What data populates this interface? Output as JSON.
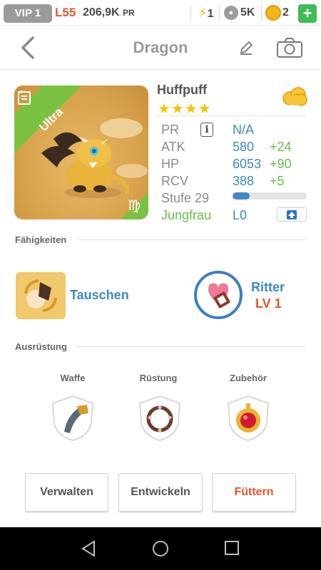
{
  "topbar": {
    "vip": "VIP 1",
    "level": "L55",
    "pr_value": "206,9K",
    "pr_unit": "PR",
    "energy": "1",
    "paws": "5K",
    "coins": "2",
    "plus": "+"
  },
  "header": {
    "title": "Dragon"
  },
  "pet": {
    "rarity": "Ultra",
    "name": "Huffpuff",
    "stars": "★★★★",
    "zodiac_glyph": "♍",
    "stats": {
      "pr_label": "PR",
      "pr_value": "N/A",
      "atk_label": "ATK",
      "atk_value": "580",
      "atk_bonus": "+24",
      "hp_label": "HP",
      "hp_value": "6053",
      "hp_bonus": "+90",
      "rcv_label": "RCV",
      "rcv_value": "388",
      "rcv_bonus": "+5",
      "stufe_label": "Stufe 29",
      "xp_progress": 0.23,
      "sign_label": "Jungfrau",
      "sign_value": "L0"
    }
  },
  "skills": {
    "title": "Fähigkeiten",
    "active": {
      "label": "Tauschen"
    },
    "passive": {
      "name": "Ritter",
      "level": "LV 1"
    }
  },
  "equipment": {
    "title": "Ausrüstung",
    "slots": [
      {
        "label": "Waffe"
      },
      {
        "label": "Rüstung"
      },
      {
        "label": "Zubehör"
      }
    ]
  },
  "actions": {
    "manage": "Verwalten",
    "evolve": "Entwickeln",
    "feed": "Füttern"
  },
  "colors": {
    "accent_blue": "#3e88c7",
    "bonus_green": "#6abf45",
    "alert_orange": "#e4572e",
    "star_yellow": "#f5c400",
    "rarity_green": "#7cc242"
  }
}
